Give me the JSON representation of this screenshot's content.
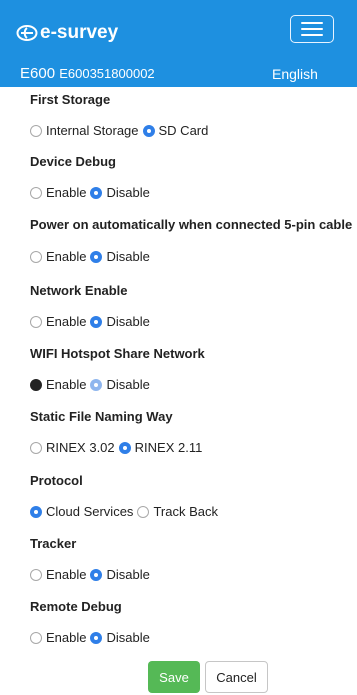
{
  "header": {
    "brand": "e-survey",
    "brand_icon": "e-survey-logo-icon",
    "menu_icon": "hamburger-menu-icon",
    "device_model": "E600",
    "device_serial": "E600351800002",
    "language": "English",
    "bg_color": "#1e90e0"
  },
  "sections": [
    {
      "title": "First Storage",
      "options": [
        {
          "label": "Internal Storage",
          "state": "unchecked"
        },
        {
          "label": "SD Card",
          "state": "checked"
        }
      ]
    },
    {
      "title": "Device Debug",
      "options": [
        {
          "label": "Enable",
          "state": "unchecked"
        },
        {
          "label": "Disable",
          "state": "checked"
        }
      ]
    },
    {
      "title": "Power on automatically when connected 5-pin cable",
      "options": [
        {
          "label": "Enable",
          "state": "unchecked"
        },
        {
          "label": "Disable",
          "state": "checked"
        }
      ]
    },
    {
      "title": "Network Enable",
      "options": [
        {
          "label": "Enable",
          "state": "unchecked"
        },
        {
          "label": "Disable",
          "state": "checked"
        }
      ]
    },
    {
      "title": "WIFI Hotspot Share Network",
      "options": [
        {
          "label": "Enable",
          "state": "disabled-dark"
        },
        {
          "label": "Disable",
          "state": "checked-disabled"
        }
      ]
    },
    {
      "title": "Static File Naming Way",
      "options": [
        {
          "label": "RINEX 3.02",
          "state": "unchecked"
        },
        {
          "label": "RINEX 2.11",
          "state": "checked"
        }
      ]
    },
    {
      "title": "Protocol",
      "options": [
        {
          "label": "Cloud Services",
          "state": "checked"
        },
        {
          "label": "Track Back",
          "state": "unchecked"
        }
      ]
    },
    {
      "title": "Tracker",
      "options": [
        {
          "label": "Enable",
          "state": "unchecked"
        },
        {
          "label": "Disable",
          "state": "checked"
        }
      ]
    },
    {
      "title": "Remote Debug",
      "options": [
        {
          "label": "Enable",
          "state": "unchecked"
        },
        {
          "label": "Disable",
          "state": "checked"
        }
      ]
    }
  ],
  "actions": {
    "save": "Save",
    "cancel": "Cancel",
    "save_color": "#55b956"
  }
}
